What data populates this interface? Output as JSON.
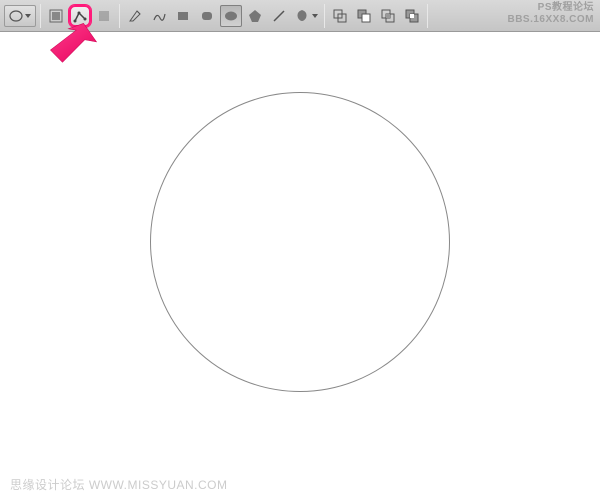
{
  "toolbar": {
    "tool_preset": "ellipse-preset",
    "shape_modes": {
      "shape_layers": "shape-layers-mode",
      "paths": "paths-mode",
      "fill_pixels": "fill-pixels-mode"
    },
    "tools": {
      "pen": "pen-tool",
      "freeform_pen": "freeform-pen-tool",
      "rectangle": "rectangle-tool",
      "rounded_rectangle": "rounded-rectangle-tool",
      "ellipse": "ellipse-tool",
      "polygon": "polygon-tool",
      "line": "line-tool",
      "custom_shape": "custom-shape-tool"
    },
    "path_ops": {
      "add": "add-to-path",
      "subtract": "subtract-from-path",
      "intersect": "intersect-path",
      "exclude": "exclude-path"
    }
  },
  "watermarks": {
    "top_right_line1": "PS教程论坛",
    "top_right_line2": "BBS.16XX8.COM",
    "bottom_left": "思缘设计论坛  WWW.MISSYUAN.COM"
  },
  "canvas": {
    "shape": "circle-path"
  }
}
